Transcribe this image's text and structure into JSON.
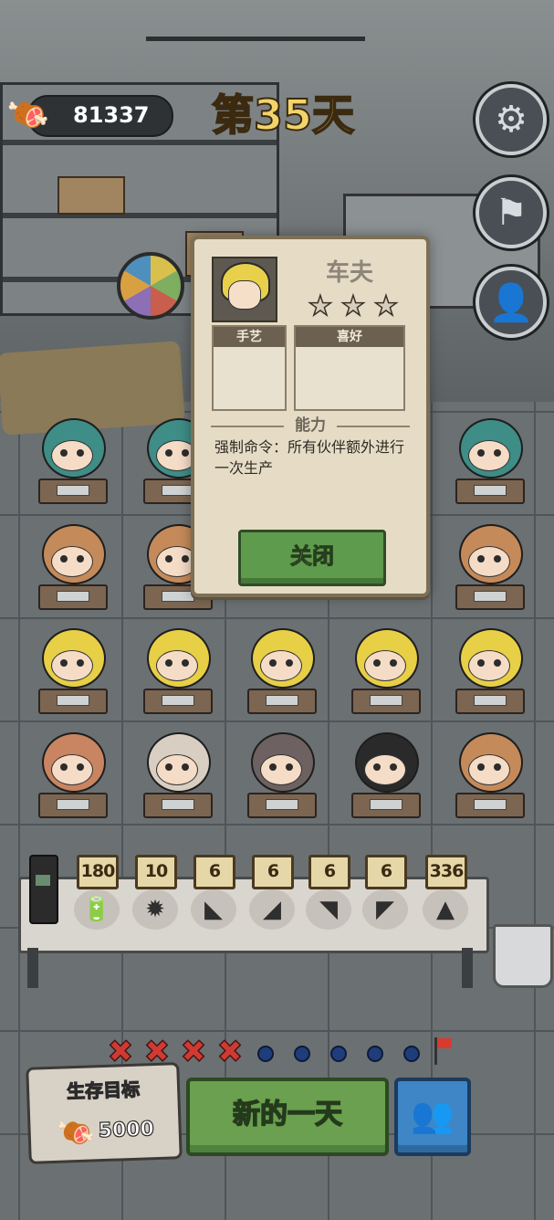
{
  "hud": {
    "food_icon": "meat-icon",
    "food_count": "81337",
    "day_title": "第35天"
  },
  "side_buttons": [
    {
      "name": "settings-button",
      "icon": "gear-icon",
      "glyph": "⚙"
    },
    {
      "name": "flag-button",
      "icon": "flag-icon",
      "glyph": "⚑"
    },
    {
      "name": "profile-button",
      "icon": "user-search-icon",
      "glyph": "👤"
    }
  ],
  "dialog": {
    "name": "车夫",
    "stars": [
      "★",
      "★",
      "★"
    ],
    "craft_header": "手艺",
    "hobby_header": "喜好",
    "ability_header": "能力",
    "ability_text": "强制命令：所有伙伴额外进行一次生产",
    "close_label": "关闭"
  },
  "characters": {
    "rows": [
      [
        "helmet",
        "helmet",
        "",
        "",
        "helmet"
      ],
      [
        "goggles",
        "goggles",
        "",
        "",
        "goggles"
      ],
      [
        "blond",
        "blond",
        "blond",
        "blond",
        "blond"
      ],
      [
        "curly",
        "bun",
        "gray",
        "spiky",
        "goggles"
      ]
    ]
  },
  "inventory": {
    "items": [
      {
        "count": "180",
        "icon": "battery-icon",
        "glyph": "🔋"
      },
      {
        "count": "10",
        "icon": "robot-spider-icon",
        "glyph": "✹"
      },
      {
        "count": "6",
        "icon": "armor-piece-icon",
        "glyph": "◣"
      },
      {
        "count": "6",
        "icon": "armor-piece-icon",
        "glyph": "◢"
      },
      {
        "count": "6",
        "icon": "armor-piece-icon",
        "glyph": "◥"
      },
      {
        "count": "6",
        "icon": "armor-piece-icon",
        "glyph": "◤"
      },
      {
        "count": "336",
        "icon": "shark-icon",
        "glyph": "▲"
      }
    ]
  },
  "progress": {
    "marks": [
      "✖",
      "✖",
      "✖",
      "✖"
    ],
    "pending_days": 5,
    "goal_icon": "flag-icon"
  },
  "bottom": {
    "goal_title": "生存目标",
    "goal_value": "5000",
    "new_day_label": "新的一天",
    "team_icon": "team-icon",
    "team_glyph": "👥"
  }
}
